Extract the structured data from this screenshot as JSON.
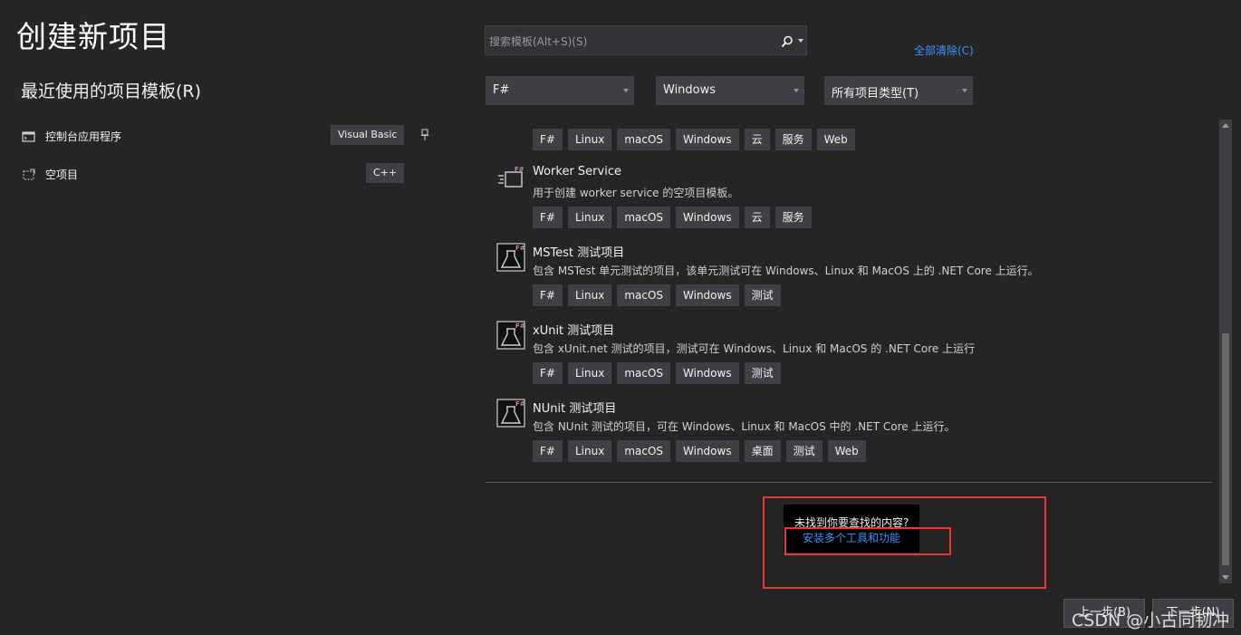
{
  "page": {
    "title": "创建新项目"
  },
  "recent": {
    "title": "最近使用的项目模板(R)",
    "items": [
      {
        "label": "控制台应用程序",
        "language": "Visual Basic",
        "icon": "console-app-icon",
        "pinned": true
      },
      {
        "label": "空项目",
        "language": "C++",
        "icon": "empty-project-icon",
        "pinned": false
      }
    ]
  },
  "search": {
    "placeholder": "搜索模板(Alt+S)(S)",
    "icon": "search-icon"
  },
  "clear_all": "全部清除(C)",
  "filters": {
    "language": "F#",
    "platform": "Windows",
    "project_type": "所有项目类型(T)"
  },
  "templates": [
    {
      "name": "",
      "description": "",
      "tags": [
        "F#",
        "Linux",
        "macOS",
        "Windows",
        "云",
        "服务",
        "Web"
      ]
    },
    {
      "name": "Worker Service",
      "description": "用于创建 worker service 的空项目模板。",
      "tags": [
        "F#",
        "Linux",
        "macOS",
        "Windows",
        "云",
        "服务"
      ]
    },
    {
      "name": "MSTest 测试项目",
      "description": "包含 MSTest 单元测试的项目，该单元测试可在 Windows、Linux 和 MacOS 上的 .NET Core 上运行。",
      "tags": [
        "F#",
        "Linux",
        "macOS",
        "Windows",
        "测试"
      ]
    },
    {
      "name": "xUnit 测试项目",
      "description": "包含 xUnit.net 测试的项目，测试可在 Windows、Linux 和 MacOS 的 .NET Core 上运行",
      "tags": [
        "F#",
        "Linux",
        "macOS",
        "Windows",
        "测试"
      ]
    },
    {
      "name": "NUnit 测试项目",
      "description": "包含 NUnit 测试的项目，可在 Windows、Linux 和 MacOS 中的 .NET Core 上运行。",
      "tags": [
        "F#",
        "Linux",
        "macOS",
        "Windows",
        "桌面",
        "测试",
        "Web"
      ]
    }
  ],
  "not_found": {
    "question": "未找到你要查找的内容?",
    "link": "安装多个工具和功能"
  },
  "buttons": {
    "back": "上一步(B)",
    "next": "下一步(N)"
  },
  "watermark": "CSDN @小古同韧冲",
  "colors": {
    "background": "#252526",
    "accent_link": "#3794ff",
    "tag_bg": "#3f3f46",
    "highlight": "#e53935",
    "fsharp_badge": "#c586c0"
  }
}
